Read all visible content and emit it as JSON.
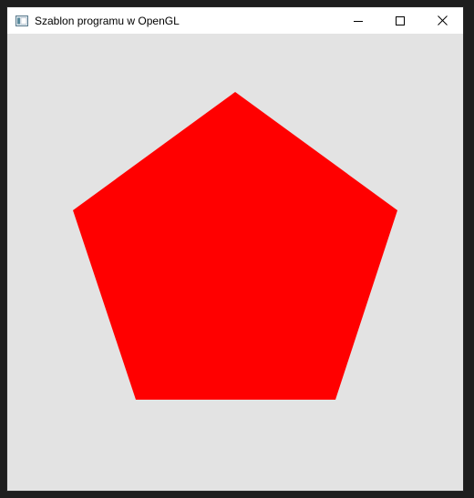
{
  "window": {
    "title": "Szablon programu w OpenGL",
    "icon": "app-window-icon"
  },
  "controls": {
    "minimize": "minimize-icon",
    "maximize": "maximize-icon",
    "close": "close-icon"
  },
  "canvas": {
    "background": "#e3e3e3",
    "shape": "pentagon",
    "fill": "#ff0000"
  }
}
